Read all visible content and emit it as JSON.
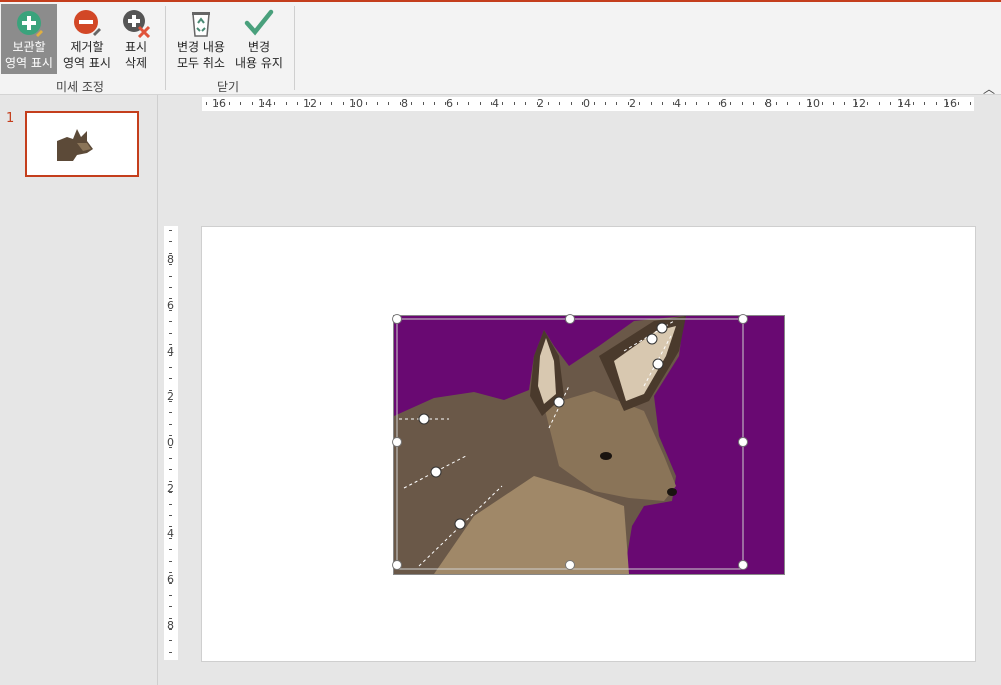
{
  "ribbon": {
    "buttons": [
      {
        "name": "mark-keep-button",
        "icon": "plus-circle-icon",
        "line1": "보관할",
        "line2": "영역 표시",
        "color": "#3aa37c"
      },
      {
        "name": "mark-remove-button",
        "icon": "minus-circle-icon",
        "line1": "제거할",
        "line2": "영역 표시",
        "color": "#d24726"
      },
      {
        "name": "delete-mark-button",
        "icon": "delete-mark-icon",
        "line1": "표시",
        "line2": "삭제",
        "color": "#555555"
      },
      {
        "name": "discard-changes-button",
        "icon": "recycle-bin-icon",
        "line1": "변경 내용",
        "line2": "모두 취소",
        "color": "#4a8a74"
      },
      {
        "name": "keep-changes-button",
        "icon": "checkmark-icon",
        "line1": "변경",
        "line2": "내용 유지",
        "color": "#49a07c"
      }
    ],
    "group_refine": "미세 조정",
    "group_close": "닫기"
  },
  "thumbnail": {
    "slide_number": "1"
  },
  "rulers": {
    "horizontal": [
      "16",
      "14",
      "12",
      "10",
      "8",
      "6",
      "4",
      "2",
      "0",
      "2",
      "4",
      "6",
      "8",
      "10",
      "12",
      "14",
      "16"
    ],
    "vertical": [
      "8",
      "6",
      "4",
      "2",
      "0",
      "2",
      "4",
      "6",
      "8"
    ]
  },
  "colors": {
    "accent": "#c43e1c",
    "magenta": "#6f0a78"
  }
}
